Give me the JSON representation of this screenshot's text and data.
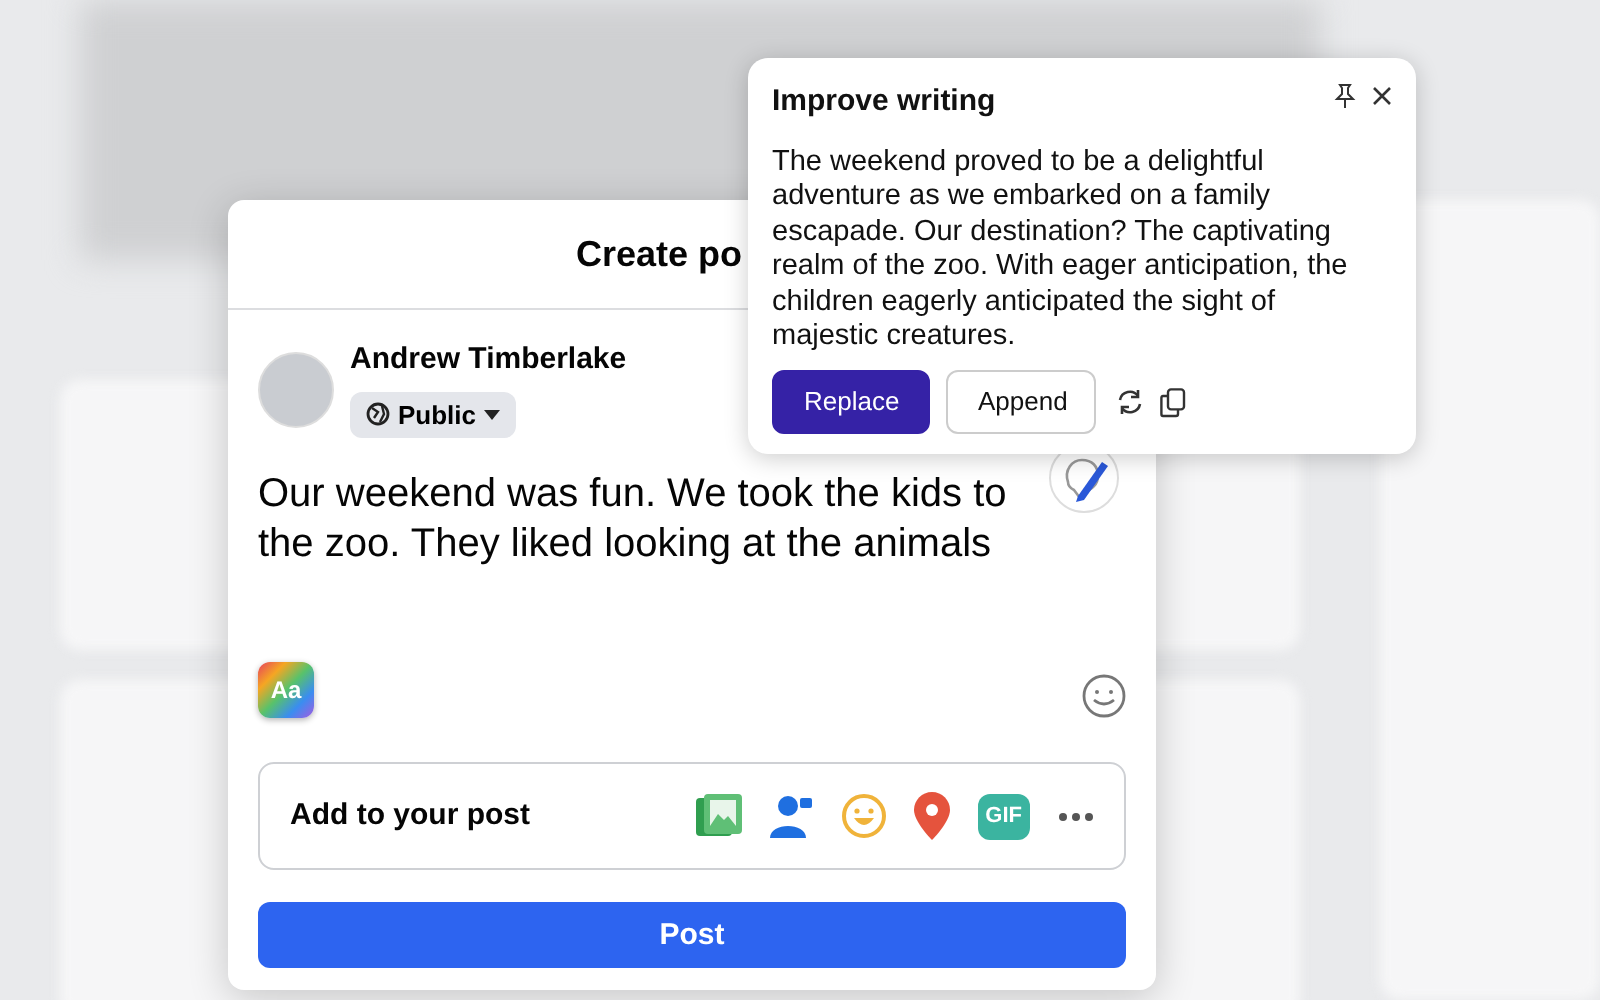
{
  "composer": {
    "title": "Create po",
    "author": "Andrew Timberlake",
    "audience": "Public",
    "text": "Our weekend was fun. We took the kids to the zoo. They liked looking at the animals",
    "text_style_label": "Aa",
    "add_label": "Add to your post",
    "gif_label": "GIF",
    "post_button": "Post"
  },
  "suggestion": {
    "title": "Improve writing",
    "text": "The weekend proved to be a delightful adventure as we embarked on a family escapade. Our destination? The captivating realm of the zoo. With eager anticipation, the children eagerly anticipated the sight of majestic creatures.",
    "buttons": [
      {
        "label": "Replace",
        "primary": true
      },
      {
        "label": "Append",
        "primary": false
      }
    ]
  }
}
